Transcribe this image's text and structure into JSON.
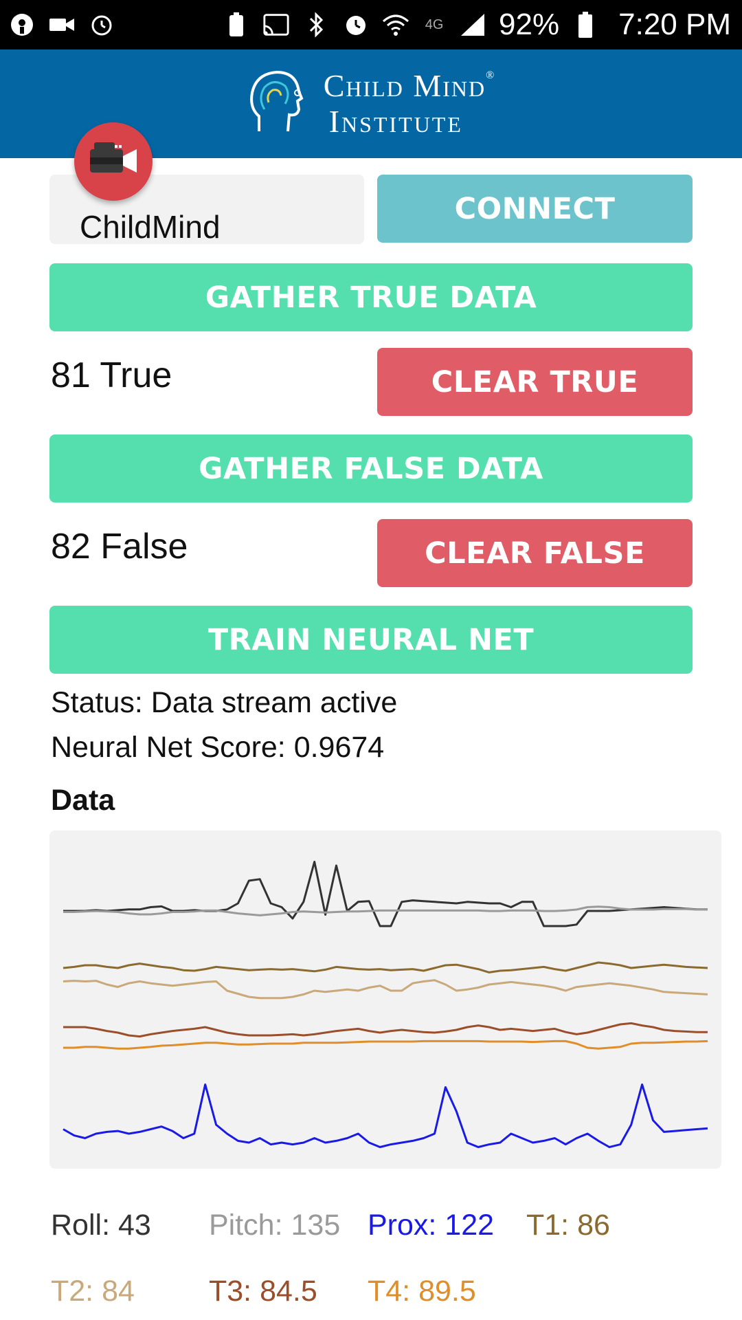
{
  "status_bar": {
    "battery": "92%",
    "time": "7:20 PM",
    "network": "4G"
  },
  "header": {
    "logo_line1": "Child Mind",
    "logo_line2": "Institute",
    "registered": "®"
  },
  "device": {
    "name": "ChildMind",
    "connect_label": "CONNECT"
  },
  "training": {
    "gather_true_label": "GATHER TRUE DATA",
    "true_count_text": "81 True",
    "clear_true_label": "CLEAR TRUE",
    "gather_false_label": "GATHER FALSE DATA",
    "false_count_text": "82 False",
    "clear_false_label": "CLEAR FALSE",
    "train_label": "TRAIN NEURAL NET"
  },
  "status": {
    "status_text": "Status: Data stream active",
    "score_text": "Neural Net Score: 0.9674"
  },
  "data_section": {
    "heading": "Data"
  },
  "readouts": {
    "roll": "Roll: 43",
    "pitch": "Pitch: 135",
    "prox": "Prox: 122",
    "t1": "T1: 86",
    "t2": "T2: 84",
    "t3": "T3: 84.5",
    "t4": "T4: 89.5"
  },
  "colors": {
    "header_bg": "#0467a4",
    "connect_bg": "#6cc3cc",
    "green_button": "#55dfae",
    "red_button": "#e05c66",
    "roll": "#333333",
    "pitch": "#9a9a9a",
    "prox": "#1a1ae6",
    "t1": "#8a6a2e",
    "t2": "#c9a87a",
    "t3": "#9b4e2a",
    "t4": "#e08e2a"
  },
  "chart_data": {
    "type": "line",
    "title": "",
    "xlabel": "",
    "ylabel": "",
    "grid": false,
    "legend": "none",
    "series": [
      {
        "key": "roll",
        "color": "#333333",
        "values": [
          0.3,
          0.3,
          0.3,
          0.31,
          0.3,
          0.31,
          0.32,
          0.32,
          0.35,
          0.36,
          0.3,
          0.3,
          0.31,
          0.3,
          0.3,
          0.32,
          0.4,
          0.7,
          0.72,
          0.4,
          0.35,
          0.2,
          0.42,
          0.95,
          0.25,
          0.9,
          0.3,
          0.42,
          0.43,
          0.1,
          0.1,
          0.42,
          0.44,
          0.43,
          0.42,
          0.41,
          0.4,
          0.42,
          0.41,
          0.4,
          0.4,
          0.35,
          0.42,
          0.42,
          0.1,
          0.1,
          0.1,
          0.12,
          0.3,
          0.3,
          0.3,
          0.31,
          0.32,
          0.33,
          0.34,
          0.35,
          0.34,
          0.33,
          0.32,
          0.32
        ]
      },
      {
        "key": "pitch",
        "color": "#9a9a9a",
        "values": [
          0.45,
          0.45,
          0.46,
          0.47,
          0.46,
          0.45,
          0.42,
          0.4,
          0.4,
          0.42,
          0.45,
          0.45,
          0.46,
          0.48,
          0.48,
          0.45,
          0.42,
          0.4,
          0.38,
          0.4,
          0.42,
          0.45,
          0.46,
          0.45,
          0.44,
          0.45,
          0.46,
          0.46,
          0.47,
          0.48,
          0.48,
          0.48,
          0.48,
          0.48,
          0.48,
          0.48,
          0.48,
          0.48,
          0.48,
          0.47,
          0.47,
          0.48,
          0.48,
          0.48,
          0.47,
          0.47,
          0.48,
          0.5,
          0.55,
          0.56,
          0.55,
          0.52,
          0.5,
          0.5,
          0.5,
          0.51,
          0.51,
          0.51,
          0.5,
          0.5
        ]
      },
      {
        "key": "t1",
        "color": "#8a6a2e",
        "values": [
          0.5,
          0.52,
          0.55,
          0.55,
          0.52,
          0.5,
          0.55,
          0.58,
          0.55,
          0.52,
          0.5,
          0.46,
          0.45,
          0.48,
          0.52,
          0.5,
          0.48,
          0.46,
          0.47,
          0.48,
          0.47,
          0.48,
          0.46,
          0.44,
          0.47,
          0.52,
          0.5,
          0.48,
          0.47,
          0.48,
          0.46,
          0.47,
          0.48,
          0.45,
          0.5,
          0.55,
          0.56,
          0.52,
          0.48,
          0.42,
          0.45,
          0.46,
          0.48,
          0.5,
          0.52,
          0.48,
          0.45,
          0.5,
          0.55,
          0.6,
          0.58,
          0.55,
          0.5,
          0.52,
          0.54,
          0.56,
          0.54,
          0.52,
          0.51,
          0.5
        ]
      },
      {
        "key": "t2",
        "color": "#c9a87a",
        "values": [
          0.45,
          0.46,
          0.45,
          0.46,
          0.4,
          0.36,
          0.42,
          0.45,
          0.42,
          0.4,
          0.38,
          0.4,
          0.42,
          0.44,
          0.45,
          0.3,
          0.25,
          0.2,
          0.18,
          0.18,
          0.18,
          0.2,
          0.24,
          0.3,
          0.28,
          0.3,
          0.32,
          0.3,
          0.35,
          0.38,
          0.3,
          0.3,
          0.42,
          0.45,
          0.47,
          0.4,
          0.3,
          0.32,
          0.35,
          0.4,
          0.42,
          0.44,
          0.42,
          0.4,
          0.38,
          0.35,
          0.3,
          0.36,
          0.38,
          0.4,
          0.42,
          0.4,
          0.38,
          0.35,
          0.32,
          0.28,
          0.27,
          0.26,
          0.25,
          0.24
        ]
      },
      {
        "key": "t3",
        "color": "#9b4e2a",
        "values": [
          0.55,
          0.55,
          0.55,
          0.52,
          0.48,
          0.45,
          0.4,
          0.38,
          0.42,
          0.45,
          0.48,
          0.5,
          0.52,
          0.55,
          0.5,
          0.45,
          0.42,
          0.4,
          0.4,
          0.4,
          0.41,
          0.42,
          0.4,
          0.42,
          0.45,
          0.48,
          0.5,
          0.52,
          0.48,
          0.45,
          0.48,
          0.5,
          0.48,
          0.46,
          0.45,
          0.47,
          0.5,
          0.55,
          0.58,
          0.55,
          0.5,
          0.52,
          0.5,
          0.48,
          0.5,
          0.52,
          0.46,
          0.42,
          0.45,
          0.5,
          0.55,
          0.6,
          0.62,
          0.58,
          0.55,
          0.5,
          0.48,
          0.47,
          0.46,
          0.46
        ]
      },
      {
        "key": "t4",
        "color": "#e08e2a",
        "values": [
          0.4,
          0.4,
          0.42,
          0.42,
          0.4,
          0.38,
          0.38,
          0.4,
          0.42,
          0.45,
          0.46,
          0.48,
          0.5,
          0.52,
          0.52,
          0.5,
          0.48,
          0.48,
          0.49,
          0.5,
          0.5,
          0.5,
          0.52,
          0.52,
          0.52,
          0.52,
          0.53,
          0.54,
          0.55,
          0.55,
          0.55,
          0.55,
          0.55,
          0.56,
          0.56,
          0.56,
          0.56,
          0.56,
          0.56,
          0.55,
          0.55,
          0.55,
          0.55,
          0.54,
          0.55,
          0.56,
          0.56,
          0.5,
          0.4,
          0.38,
          0.4,
          0.42,
          0.5,
          0.52,
          0.52,
          0.53,
          0.54,
          0.55,
          0.55,
          0.56
        ]
      },
      {
        "key": "prox",
        "color": "#1a1ae6",
        "values": [
          0.35,
          0.28,
          0.25,
          0.3,
          0.32,
          0.33,
          0.3,
          0.32,
          0.35,
          0.38,
          0.33,
          0.25,
          0.3,
          0.85,
          0.4,
          0.3,
          0.22,
          0.2,
          0.25,
          0.18,
          0.2,
          0.18,
          0.2,
          0.25,
          0.2,
          0.22,
          0.25,
          0.3,
          0.2,
          0.15,
          0.18,
          0.2,
          0.22,
          0.25,
          0.3,
          0.82,
          0.55,
          0.2,
          0.15,
          0.18,
          0.2,
          0.3,
          0.25,
          0.2,
          0.22,
          0.25,
          0.18,
          0.25,
          0.3,
          0.22,
          0.15,
          0.18,
          0.4,
          0.85,
          0.45,
          0.32,
          0.33,
          0.34,
          0.35,
          0.36
        ]
      }
    ]
  }
}
